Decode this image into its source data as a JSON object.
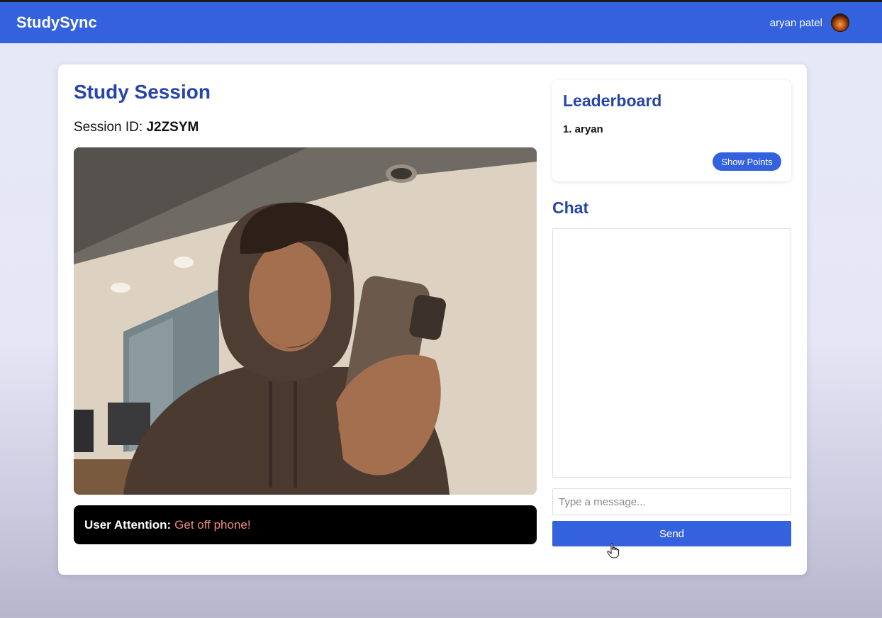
{
  "header": {
    "brand": "StudySync",
    "user_name": "aryan patel",
    "avatar_icon": "user-avatar"
  },
  "session": {
    "title": "Study Session",
    "id_label": "Session ID:",
    "id_value": "J2ZSYM",
    "video_feed": "webcam-video",
    "attention_label": "User Attention:",
    "attention_value": "Get off phone!"
  },
  "leaderboard": {
    "title": "Leaderboard",
    "entries": [
      "1. aryan"
    ],
    "show_points_label": "Show Points"
  },
  "chat": {
    "title": "Chat",
    "input_placeholder": "Type a message...",
    "send_label": "Send"
  },
  "colors": {
    "brand_blue": "#3462de",
    "heading_blue": "#2645a8",
    "attention_warning": "#f08a85"
  }
}
